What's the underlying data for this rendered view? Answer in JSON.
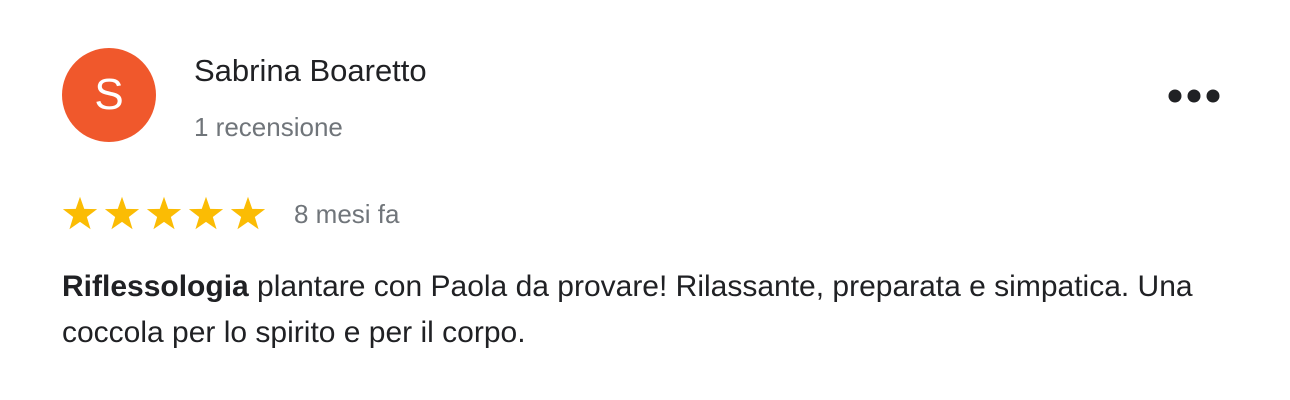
{
  "reviewer": {
    "initial": "S",
    "name": "Sabrina Boaretto",
    "review_count": "1 recensione",
    "avatar_color": "#f0582c"
  },
  "menu": {
    "icon": "more-horizontal-icon"
  },
  "rating": {
    "stars": 5,
    "max_stars": 5,
    "star_color": "#fbbc04",
    "date": "8 mesi fa"
  },
  "review": {
    "highlight": "Riflessologia",
    "text": " plantare con Paola da provare! Rilassante, preparata e simpatica. Una coccola per lo spirito e per il corpo."
  }
}
